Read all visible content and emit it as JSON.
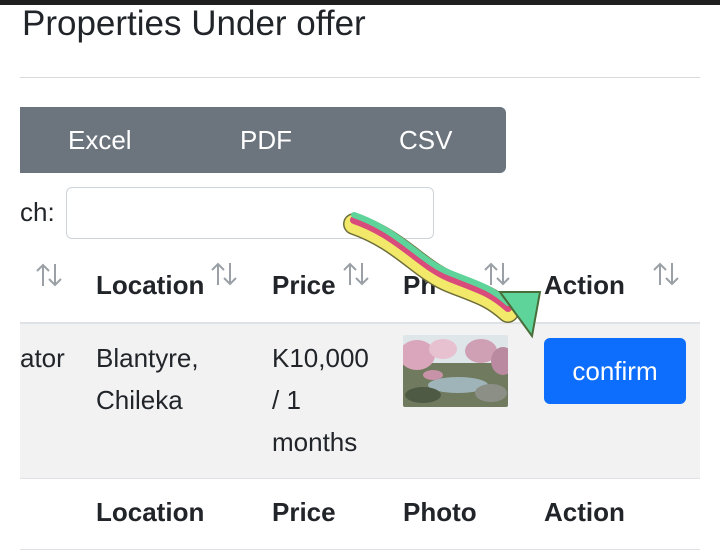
{
  "page": {
    "title": "Properties Under offer"
  },
  "export_buttons": {
    "excel": "Excel",
    "pdf": "PDF",
    "csv": "CSV"
  },
  "search": {
    "label": "ch:",
    "value": ""
  },
  "table": {
    "headers": {
      "location": "Location",
      "price": "Price",
      "photo": "Ph",
      "action": "Action"
    },
    "rows": [
      {
        "prev_col": "ator",
        "location_line1": "Blantyre,",
        "location_line2": "Chileka",
        "price_line1": "K10,000",
        "price_line2": "/ 1",
        "price_line3": "months",
        "action": "confirm"
      }
    ],
    "footer": {
      "location": "Location",
      "price": "Price",
      "photo": "Photo",
      "action": "Action"
    }
  },
  "colors": {
    "primary": "#0d6efd",
    "secondary": "#6c757d",
    "row_stripe": "#f2f2f2"
  }
}
